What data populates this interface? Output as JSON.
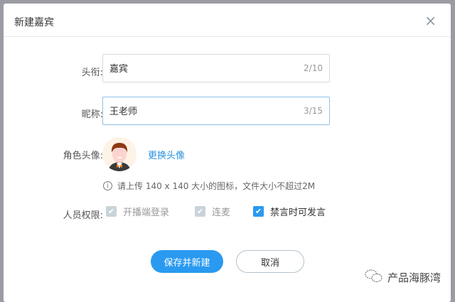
{
  "dialog": {
    "title": "新建嘉宾",
    "close": "×"
  },
  "form": {
    "title_label": "头衔:",
    "title_value": "嘉宾",
    "title_count": "2/10",
    "nick_label": "昵称:",
    "nick_value": "王老师",
    "nick_count": "3/15",
    "avatar_label": "角色头像:",
    "change_avatar": "更换头像",
    "tip": "请上传 140 x 140 大小的图标，文件大小不超过2M",
    "perm_label": "人员权限:",
    "perms": [
      {
        "label": "开播端登录",
        "checked": true,
        "disabled": true
      },
      {
        "label": "连麦",
        "checked": true,
        "disabled": true
      },
      {
        "label": "禁言时可发言",
        "checked": true,
        "disabled": false
      }
    ]
  },
  "buttons": {
    "save": "保存并新建",
    "cancel": "取消"
  },
  "watermark": "产品海豚湾",
  "colors": {
    "primary": "#2a9af0",
    "disabled": "#c9d3da"
  }
}
